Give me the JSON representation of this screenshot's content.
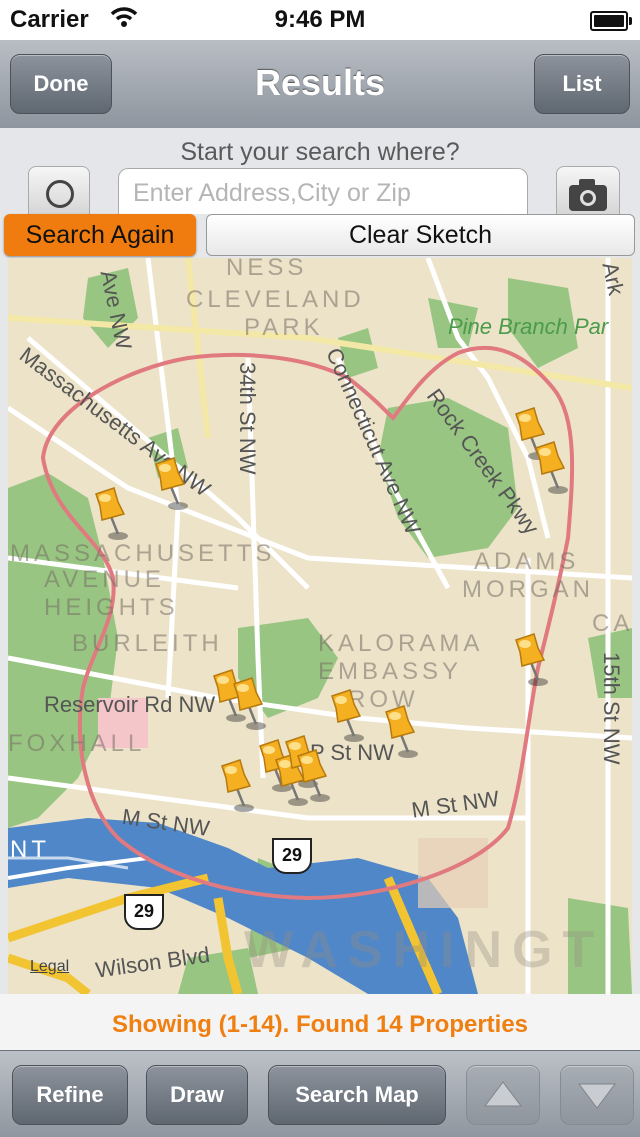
{
  "status": {
    "carrier": "Carrier",
    "time": "9:46 PM"
  },
  "nav": {
    "title": "Results",
    "done": "Done",
    "list": "List"
  },
  "search": {
    "prompt": "Start your search where?",
    "placeholder": "Enter Address,City or Zip",
    "search_again": "Search Again",
    "clear_sketch": "Clear Sketch"
  },
  "map": {
    "streets": [
      "Ave NW",
      "Massachusetts Ave NW",
      "34th St NW",
      "Connecticut Ave NW",
      "Rock Creek Pkwy",
      "Reservoir Rd NW",
      "P St NW",
      "M St NW",
      "M St NW",
      "Wilson Blvd",
      "15th St NW",
      "Ark"
    ],
    "districts": [
      "NESS",
      "CLEVELAND",
      "PARK",
      "MASSACHUSETTS",
      "AVENUE",
      "HEIGHTS",
      "BURLEITH",
      "FOXHALL",
      "KALORAMA",
      "EMBASSY",
      "ROW",
      "ADAMS",
      "MORGAN",
      "WASHINGT",
      "CA",
      "NT"
    ],
    "parks": [
      "Pine Branch Par"
    ],
    "route_shields": [
      "29",
      "29"
    ],
    "legal": "Legal",
    "pin_count": 14
  },
  "results": {
    "text": "Showing (1-14). Found 14 Properties"
  },
  "toolbar": {
    "refine": "Refine",
    "draw": "Draw",
    "search_map": "Search Map"
  },
  "colors": {
    "accent": "#f07f12",
    "sketch": "#e07a80",
    "park": "#8fc27a",
    "water": "#4f87c9",
    "highway": "#f2c431"
  }
}
